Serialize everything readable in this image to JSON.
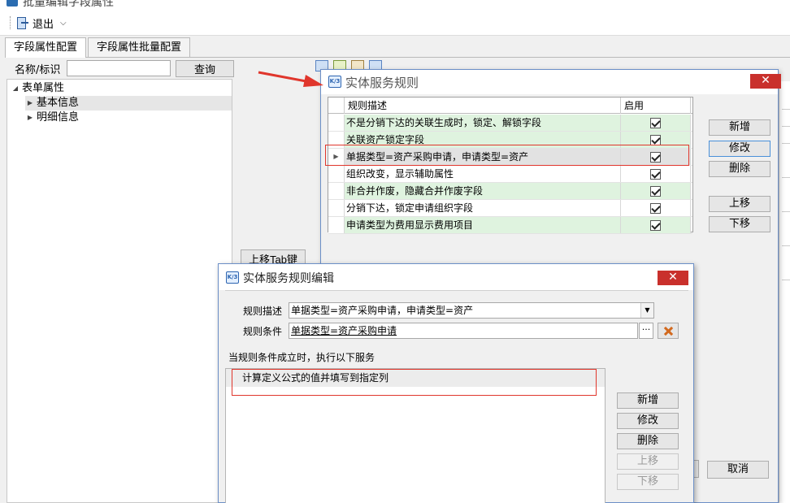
{
  "window": {
    "title": "批量编辑字段属性"
  },
  "toolbar": {
    "exit_label": "退出"
  },
  "tabs": [
    {
      "label": "字段属性配置",
      "active": true
    },
    {
      "label": "字段属性批量配置",
      "active": false
    }
  ],
  "search": {
    "label": "名称/标识",
    "value": "",
    "query_label": "查询"
  },
  "tree": {
    "root": "表单属性",
    "children": [
      "基本信息",
      "明细信息"
    ]
  },
  "move_tab_label": "上移Tab键",
  "dialog_rules": {
    "title": "实体服务规则",
    "columns": {
      "desc": "规则描述",
      "enabled": "启用"
    },
    "rows": [
      {
        "desc": "不是分销下达的关联生成时，锁定、解锁字段",
        "enabled": true
      },
      {
        "desc": "关联资产锁定字段",
        "enabled": true
      },
      {
        "desc": "单据类型=资产采购申请，申请类型=资产",
        "enabled": true
      },
      {
        "desc": "组织改变，显示辅助属性",
        "enabled": true
      },
      {
        "desc": "非合并作废，隐藏合并作废字段",
        "enabled": true
      },
      {
        "desc": "分销下达，锁定申请组织字段",
        "enabled": true
      },
      {
        "desc": "申请类型为费用显示费用项目",
        "enabled": true
      }
    ],
    "buttons": {
      "add": "新增",
      "edit": "修改",
      "delete": "删除",
      "up": "上移",
      "down": "下移",
      "cancel": "取消"
    }
  },
  "dialog_edit": {
    "title": "实体服务规则编辑",
    "desc_label": "规则描述",
    "desc_value": "单据类型=资产采购申请，申请类型=资产",
    "cond_label": "规则条件",
    "cond_value": "单据类型=资产采购申请",
    "ellipsis": "···",
    "exec_label": "当规则条件成立时，执行以下服务",
    "services": [
      "计算定义公式的值并填写到指定列"
    ],
    "buttons": {
      "add": "新增",
      "edit": "修改",
      "delete": "删除",
      "up": "上移",
      "down": "下移"
    }
  },
  "icons": {
    "close": "close-icon",
    "app": "k3-app-icon",
    "exit": "exit-icon"
  },
  "colors": {
    "accent_red": "#e0362c",
    "close_red": "#c9302c",
    "row_green": "#dff3df",
    "frame_blue": "#6c8fc7"
  }
}
